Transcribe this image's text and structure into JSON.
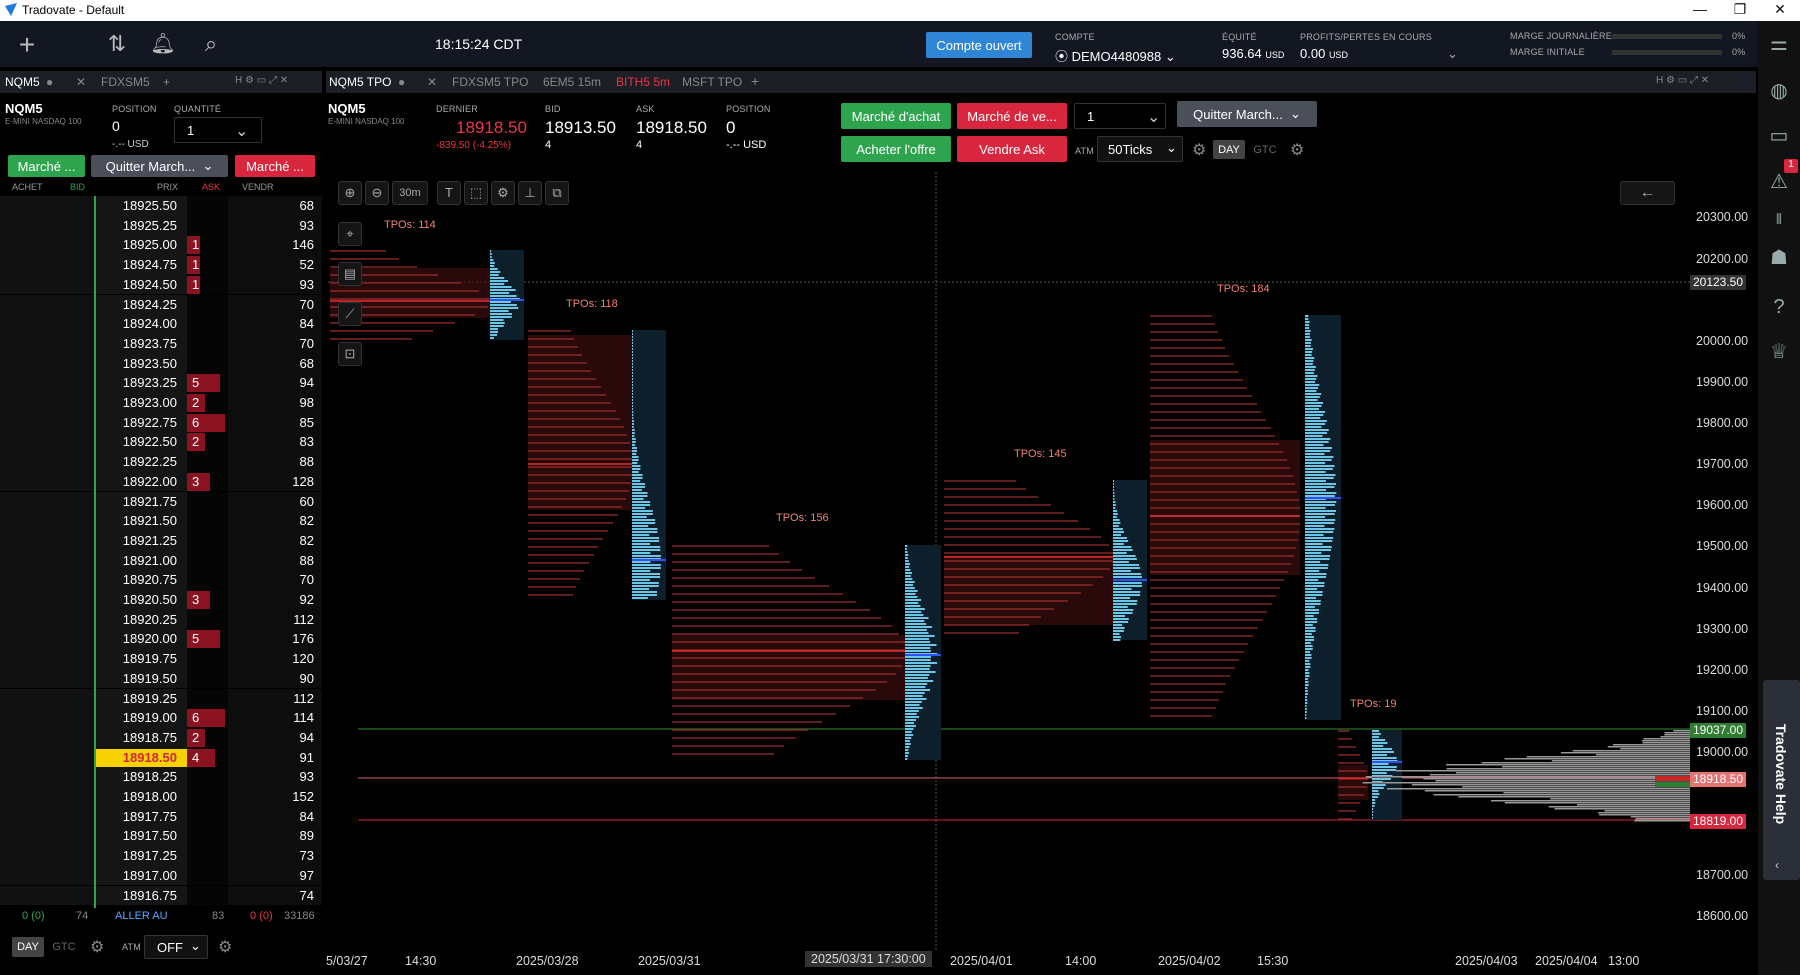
{
  "window": {
    "title": "Tradovate - Default"
  },
  "topbar": {
    "time": "18:15:24 CDT",
    "open_account": "Compte ouvert",
    "account_label": "COMPTE",
    "account_value": "DEMO4480988",
    "equity_label": "ÉQUITÉ",
    "equity_value": "936.64",
    "equity_unit": "USD",
    "pnl_label": "PROFITS/PERTES EN COURS",
    "pnl_value": "0.00",
    "pnl_unit": "USD",
    "margin_day_label": "MARGE JOURNALIÈRE",
    "margin_init_label": "MARGE INITIALE",
    "margin_day_pct": "0%",
    "margin_init_pct": "0%"
  },
  "left_tabs": {
    "active": "NQM5",
    "other": "FDXSM5"
  },
  "left_panel": {
    "symbol": "NQM5",
    "desc": "E-MINI NASDAQ 100",
    "position_label": "POSITION",
    "position_value": "0",
    "position_usd": "-.-- USD",
    "qty_label": "QUANTITÉ",
    "qty_value": "1",
    "buy_market": "Marché ...",
    "exit_market": "Quitter March...",
    "sell_market": "Marché ...",
    "col_buy": "ACHET",
    "col_bid": "BID",
    "col_price": "PRIX",
    "col_ask": "ASK",
    "col_sell": "VENDR",
    "footer_left": "0 (0)",
    "footer_bid": "74",
    "goto": "ALLER AU",
    "footer_ask": "83",
    "footer_sell": "0 (0)",
    "footer_vol": "33186",
    "day": "DAY",
    "gtc": "GTC",
    "atm_label": "ATM",
    "atm_value": "OFF"
  },
  "ladder": [
    {
      "p": "18925.50",
      "a": "",
      "v": "68"
    },
    {
      "p": "18925.25",
      "a": "",
      "v": "93"
    },
    {
      "p": "18925.00",
      "a": "1",
      "v": "146"
    },
    {
      "p": "18924.75",
      "a": "1",
      "v": "52"
    },
    {
      "p": "18924.50",
      "a": "1",
      "v": "93"
    },
    {
      "p": "18924.25",
      "a": "",
      "v": "70"
    },
    {
      "p": "18924.00",
      "a": "",
      "v": "84"
    },
    {
      "p": "18923.75",
      "a": "",
      "v": "70"
    },
    {
      "p": "18923.50",
      "a": "",
      "v": "68"
    },
    {
      "p": "18923.25",
      "a": "5",
      "v": "94"
    },
    {
      "p": "18923.00",
      "a": "2",
      "v": "98"
    },
    {
      "p": "18922.75",
      "a": "6",
      "v": "85"
    },
    {
      "p": "18922.50",
      "a": "2",
      "v": "83"
    },
    {
      "p": "18922.25",
      "a": "",
      "v": "88"
    },
    {
      "p": "18922.00",
      "a": "3",
      "v": "128"
    },
    {
      "p": "18921.75",
      "a": "",
      "v": "60"
    },
    {
      "p": "18921.50",
      "a": "",
      "v": "82"
    },
    {
      "p": "18921.25",
      "a": "",
      "v": "82"
    },
    {
      "p": "18921.00",
      "a": "",
      "v": "88"
    },
    {
      "p": "18920.75",
      "a": "",
      "v": "70"
    },
    {
      "p": "18920.50",
      "a": "3",
      "v": "92"
    },
    {
      "p": "18920.25",
      "a": "",
      "v": "112"
    },
    {
      "p": "18920.00",
      "a": "5",
      "v": "176"
    },
    {
      "p": "18919.75",
      "a": "",
      "v": "120"
    },
    {
      "p": "18919.50",
      "a": "",
      "v": "90"
    },
    {
      "p": "18919.25",
      "a": "",
      "v": "112"
    },
    {
      "p": "18919.00",
      "a": "6",
      "v": "114"
    },
    {
      "p": "18918.75",
      "a": "2",
      "v": "94"
    },
    {
      "p": "18918.50",
      "a": "4",
      "v": "91",
      "cur": true
    },
    {
      "p": "18918.25",
      "a": "",
      "v": "93"
    },
    {
      "p": "18918.00",
      "a": "",
      "v": "152"
    },
    {
      "p": "18917.75",
      "a": "",
      "v": "84"
    },
    {
      "p": "18917.50",
      "a": "",
      "v": "89"
    },
    {
      "p": "18917.25",
      "a": "",
      "v": "73"
    },
    {
      "p": "18917.00",
      "a": "",
      "v": "97"
    },
    {
      "p": "18916.75",
      "a": "",
      "v": "74"
    }
  ],
  "chart_tabs": {
    "active": "NQM5 TPO",
    "t2": "FDXSM5 TPO",
    "t3": "6EM5 15m",
    "t4": "BITH5 5m",
    "t5": "MSFT TPO"
  },
  "chart_header": {
    "symbol": "NQM5",
    "desc": "E-MINI NASDAQ 100",
    "last_label": "DERNIER",
    "last_value": "18918.50",
    "change": "-839.50 (-4.25%)",
    "bid_label": "BID",
    "bid_value": "18913.50",
    "bid_size": "4",
    "ask_label": "ASK",
    "ask_value": "18918.50",
    "ask_size": "4",
    "position_label": "POSITION",
    "position_value": "0",
    "position_usd": "-.-- USD",
    "buy_market": "Marché d'achat",
    "sell_market": "Marché de ve...",
    "qty": "1",
    "exit_market": "Quitter March...",
    "buy_bid": "Acheter l'offre",
    "sell_ask": "Vendre Ask",
    "atm_label": "ATM",
    "atm_value": "50Ticks",
    "day": "DAY",
    "gtc": "GTC"
  },
  "chart_tools": {
    "interval": "30m"
  },
  "chart_data": {
    "type": "tpo",
    "tpo_labels": [
      "TPOs: 114",
      "TPOs: 118",
      "TPOs: 156",
      "TPOs: 145",
      "TPOs: 184",
      "TPOs: 19"
    ],
    "y_ticks": [
      "20300.00",
      "20200.00",
      "20000.00",
      "19900.00",
      "19800.00",
      "19700.00",
      "19600.00",
      "19500.00",
      "19400.00",
      "19300.00",
      "19200.00",
      "19100.00",
      "19000.00",
      "18700.00",
      "18600.00"
    ],
    "price_tags": {
      "crosshair": "20123.50",
      "green": "19037.00",
      "last": "18918.50",
      "red": "18819.00"
    },
    "x_labels": [
      "5/03/27",
      "14:30",
      "2025/03/28",
      "2025/03/31",
      "2025/03/31 17:30:00",
      "2025/04/01",
      "14:00",
      "2025/04/02",
      "15:30",
      "2025/04/03",
      "2025/04/04",
      "13:00"
    ]
  },
  "help_tab": "Tradovate Help",
  "notif_count": "1"
}
